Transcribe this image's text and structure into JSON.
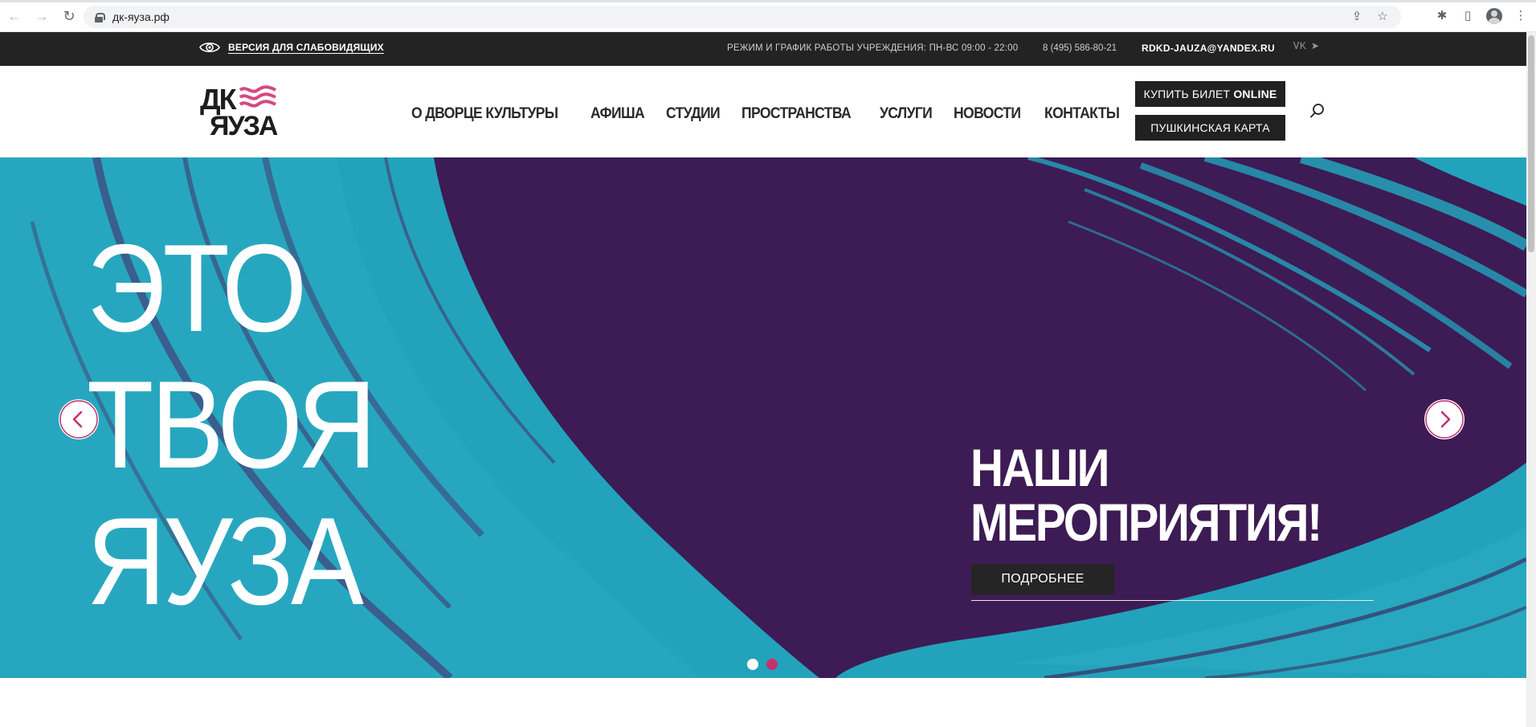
{
  "browser": {
    "url": "дк-яуза.рф",
    "icons": [
      "back-icon",
      "forward-icon",
      "reload-icon",
      "lock-icon",
      "share-icon",
      "star-icon",
      "extensions-icon",
      "sidebar-icon",
      "profile-icon",
      "menu-icon"
    ]
  },
  "topbar": {
    "accessibility_label": "ВЕРСИЯ ДЛЯ СЛАБОВИДЯЩИХ",
    "schedule": "РЕЖИМ И ГРАФИК РАБОТЫ УЧРЕЖДЕНИЯ: ПН-ВС 09:00 - 22:00",
    "phone": "8 (495) 586-80-21",
    "email": "RDKD-JAUZA@YANDEX.RU",
    "social": [
      "vk-icon",
      "telegram-icon"
    ]
  },
  "header": {
    "logo": {
      "line1": "ДК",
      "line2": "ЯУЗА"
    },
    "nav": [
      {
        "label": "О ДВОРЦЕ КУЛЬТУРЫ"
      },
      {
        "label": "АФИША"
      },
      {
        "label": "СТУДИИ"
      },
      {
        "label": "ПРОСТРАНСТВА"
      },
      {
        "label": "УСЛУГИ"
      },
      {
        "label": "НОВОСТИ"
      },
      {
        "label": "КОНТАКТЫ"
      }
    ],
    "buy_ticket_prefix": "КУПИТЬ БИЛЕТ ",
    "buy_ticket_suffix": "ONLINE",
    "pushkin_card": "ПУШКИНСКАЯ КАРТА"
  },
  "hero": {
    "title_lines": [
      "ЭТО",
      "ТВОЯ",
      "ЯУЗА"
    ],
    "slide_heading_lines": [
      "НАШИ",
      "МЕРОПРИЯТИЯ!"
    ],
    "more_button": "ПОДРОБНЕЕ",
    "active_slide": 1,
    "slide_count": 2
  },
  "colors": {
    "topbar_bg": "#232323",
    "accent_pink": "#c4326e",
    "hero_purple": "#3d1b54",
    "hero_teal": "#23a3bb",
    "button_dark": "#212121"
  }
}
